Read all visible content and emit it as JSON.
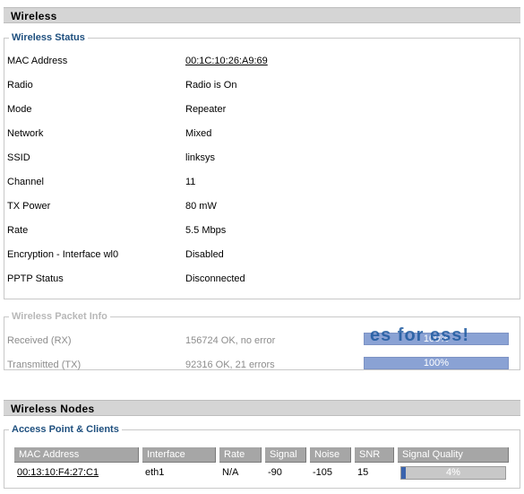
{
  "wireless": {
    "header": "Wireless",
    "status": {
      "legend": "Wireless Status",
      "rows": [
        {
          "label": "MAC Address",
          "value": "00:1C:10:26:A9:69"
        },
        {
          "label": "Radio",
          "value": "Radio is On"
        },
        {
          "label": "Mode",
          "value": "Repeater"
        },
        {
          "label": "Network",
          "value": "Mixed"
        },
        {
          "label": "SSID",
          "value": "linksys"
        },
        {
          "label": "Channel",
          "value": "11"
        },
        {
          "label": "TX Power",
          "value": "80 mW"
        },
        {
          "label": "Rate",
          "value": "5.5 Mbps"
        },
        {
          "label": "Encryption - Interface wl0",
          "value": "Disabled"
        },
        {
          "label": "PPTP Status",
          "value": "Disconnected"
        }
      ]
    },
    "packet_info": {
      "legend": "Wireless Packet Info",
      "rows": [
        {
          "label": "Received (RX)",
          "value": "156724 OK, no error",
          "bar_text": "100%",
          "bar_fraction": 1.0
        },
        {
          "label": "Transmitted (TX)",
          "value": "92316 OK, 21 errors",
          "bar_text": "100%",
          "bar_fraction": 1.0
        }
      ],
      "overlay_text": "es for ess!"
    }
  },
  "nodes": {
    "header": "Wireless Nodes",
    "legend": "Access Point & Clients",
    "columns": [
      "MAC Address",
      "Interface",
      "Rate",
      "Signal",
      "Noise",
      "SNR",
      "Signal Quality"
    ],
    "rows": [
      {
        "mac": "00:13:10:F4:27:C1",
        "interface": "eth1",
        "rate": "N/A",
        "signal": "-90",
        "noise": "-105",
        "snr": "15",
        "quality_text": "4%",
        "quality_fraction": 0.04
      }
    ]
  },
  "colors": {
    "legend": "#1e4f7e",
    "bar": "#9fb3dc",
    "quality_fill": "#3a63ad"
  }
}
